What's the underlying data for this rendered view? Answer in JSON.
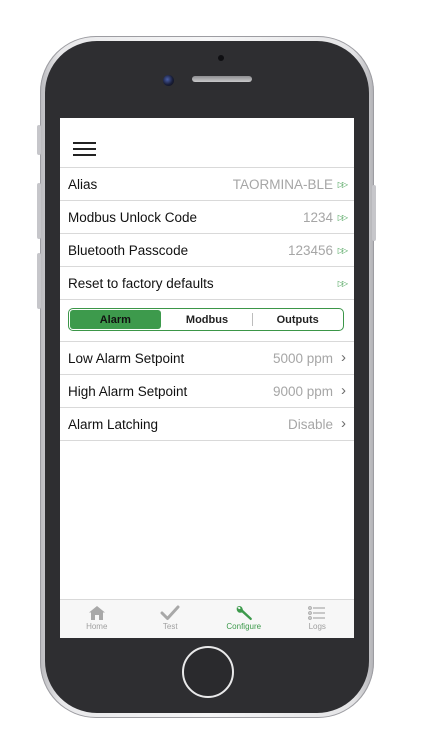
{
  "settings_rows": [
    {
      "label": "Alias",
      "value": "TAORMINA-BLE"
    },
    {
      "label": "Modbus Unlock Code",
      "value": "1234"
    },
    {
      "label": "Bluetooth Passcode",
      "value": "123456"
    },
    {
      "label": "Reset to factory defaults",
      "value": ""
    }
  ],
  "segments": [
    "Alarm",
    "Modbus",
    "Outputs"
  ],
  "selected_segment": "Alarm",
  "alarm_rows": [
    {
      "label": "Low Alarm Setpoint",
      "value": "5000 ppm"
    },
    {
      "label": "High Alarm Setpoint",
      "value": "9000 ppm"
    },
    {
      "label": "Alarm Latching",
      "value": "Disable"
    }
  ],
  "tabs": [
    {
      "label": "Home",
      "icon": "house-icon"
    },
    {
      "label": "Test",
      "icon": "checkmark-icon"
    },
    {
      "label": "Configure",
      "icon": "wrench-icon"
    },
    {
      "label": "Logs",
      "icon": "list-icon"
    }
  ],
  "active_tab": "Configure",
  "colors": {
    "accent": "#3d9a4c",
    "value_gray": "#a6a6a6"
  }
}
